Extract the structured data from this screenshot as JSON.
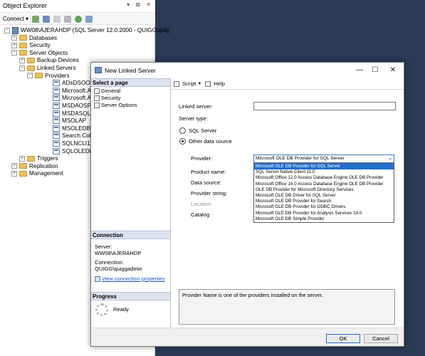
{
  "object_explorer": {
    "title": "Object Explorer",
    "controls": "▾ ⊠ ✕",
    "connect_label": "Connect ▾",
    "tree": [
      {
        "label": "WW08\\AJERAHDP (SQL Server 12.0.2000 - QUIGG\\quig",
        "level": 0,
        "expand": "−",
        "icon": "server-icon"
      },
      {
        "label": "Databases",
        "level": 1,
        "expand": "+",
        "icon": "folder-icon"
      },
      {
        "label": "Security",
        "level": 1,
        "expand": "+",
        "icon": "folder-icon"
      },
      {
        "label": "Server Objects",
        "level": 1,
        "expand": "−",
        "icon": "folder-icon"
      },
      {
        "label": "Backup Devices",
        "level": 2,
        "expand": "+",
        "icon": "folder-icon"
      },
      {
        "label": "Linked Servers",
        "level": 2,
        "expand": "−",
        "icon": "folder-icon"
      },
      {
        "label": "Providers",
        "level": 3,
        "expand": "−",
        "icon": "folder-icon"
      },
      {
        "label": "ADsDSOObject",
        "level": 4,
        "expand": "",
        "icon": "provider-icon"
      },
      {
        "label": "Microsoft.ACE",
        "level": 4,
        "expand": "",
        "icon": "provider-icon"
      },
      {
        "label": "Microsoft.ACE",
        "level": 4,
        "expand": "",
        "icon": "provider-icon"
      },
      {
        "label": "MSDAOSP",
        "level": 4,
        "expand": "",
        "icon": "provider-icon"
      },
      {
        "label": "MSDASQL",
        "level": 4,
        "expand": "",
        "icon": "provider-icon"
      },
      {
        "label": "MSOLAP",
        "level": 4,
        "expand": "",
        "icon": "provider-icon"
      },
      {
        "label": "MSOLEDBSQL",
        "level": 4,
        "expand": "",
        "icon": "provider-icon"
      },
      {
        "label": "Search.Collato",
        "level": 4,
        "expand": "",
        "icon": "provider-icon"
      },
      {
        "label": "SQLNCLI11",
        "level": 4,
        "expand": "",
        "icon": "provider-icon"
      },
      {
        "label": "SQLOLEDB",
        "level": 4,
        "expand": "",
        "icon": "provider-icon"
      },
      {
        "label": "Triggers",
        "level": 2,
        "expand": "+",
        "icon": "folder-icon"
      },
      {
        "label": "Replication",
        "level": 1,
        "expand": "+",
        "icon": "folder-icon"
      },
      {
        "label": "Management",
        "level": 1,
        "expand": "+",
        "icon": "folder-icon"
      }
    ]
  },
  "dialog": {
    "title": "New Linked Server",
    "select_page_header": "Select a page",
    "pages": [
      "General",
      "Security",
      "Server Options"
    ],
    "toolbar": {
      "script_label": "Script",
      "help_label": "Help"
    },
    "connection_header": "Connection",
    "server_label": "Server:",
    "server_value": "WW08\\AJERAHDP",
    "connection_label": "Connection:",
    "connection_value": "QUIGG\\quiggadmin",
    "view_connection_link": "View connection properties",
    "progress_header": "Progress",
    "progress_status": "Ready",
    "linked_server_label": "Linked server:",
    "linked_server_value": "",
    "server_type_label": "Server type:",
    "radio_sql_server": "SQL Server",
    "radio_other": "Other data source",
    "selected_server_type": "other",
    "provider_label": "Provider:",
    "provider_selected": "Microsoft OLE DB Provider for SQL Server",
    "provider_options": [
      "Microsoft OLE DB Provider for SQL Server",
      "SQL Server Native Client 11.0",
      "Microsoft Office 12.0 Access Database Engine OLE DB Provider",
      "Microsoft Office 16.0 Access Database Engine OLE DB Provider",
      "OLE DB Provider for Microsoft Directory Services",
      "Microsoft OLE DB Driver for SQL Server",
      "Microsoft OLE DB Provider for Search",
      "Microsoft OLE DB Provider for ODBC Drivers",
      "Microsoft OLE DB Provider for Analysis Services 14.0",
      "Microsoft OLE DB Simple Provider"
    ],
    "product_name_label": "Product name:",
    "data_source_label": "Data source:",
    "provider_string_label": "Provider string:",
    "location_label": "Location",
    "catalog_label": "Catalog",
    "description": "Provider Name is one of the providers installed on the server.",
    "ok_label": "OK",
    "cancel_label": "Cancel"
  },
  "colors": {
    "accent": "#1f6fd1",
    "desktop": "#2b3a55",
    "link": "#1a52c6"
  }
}
